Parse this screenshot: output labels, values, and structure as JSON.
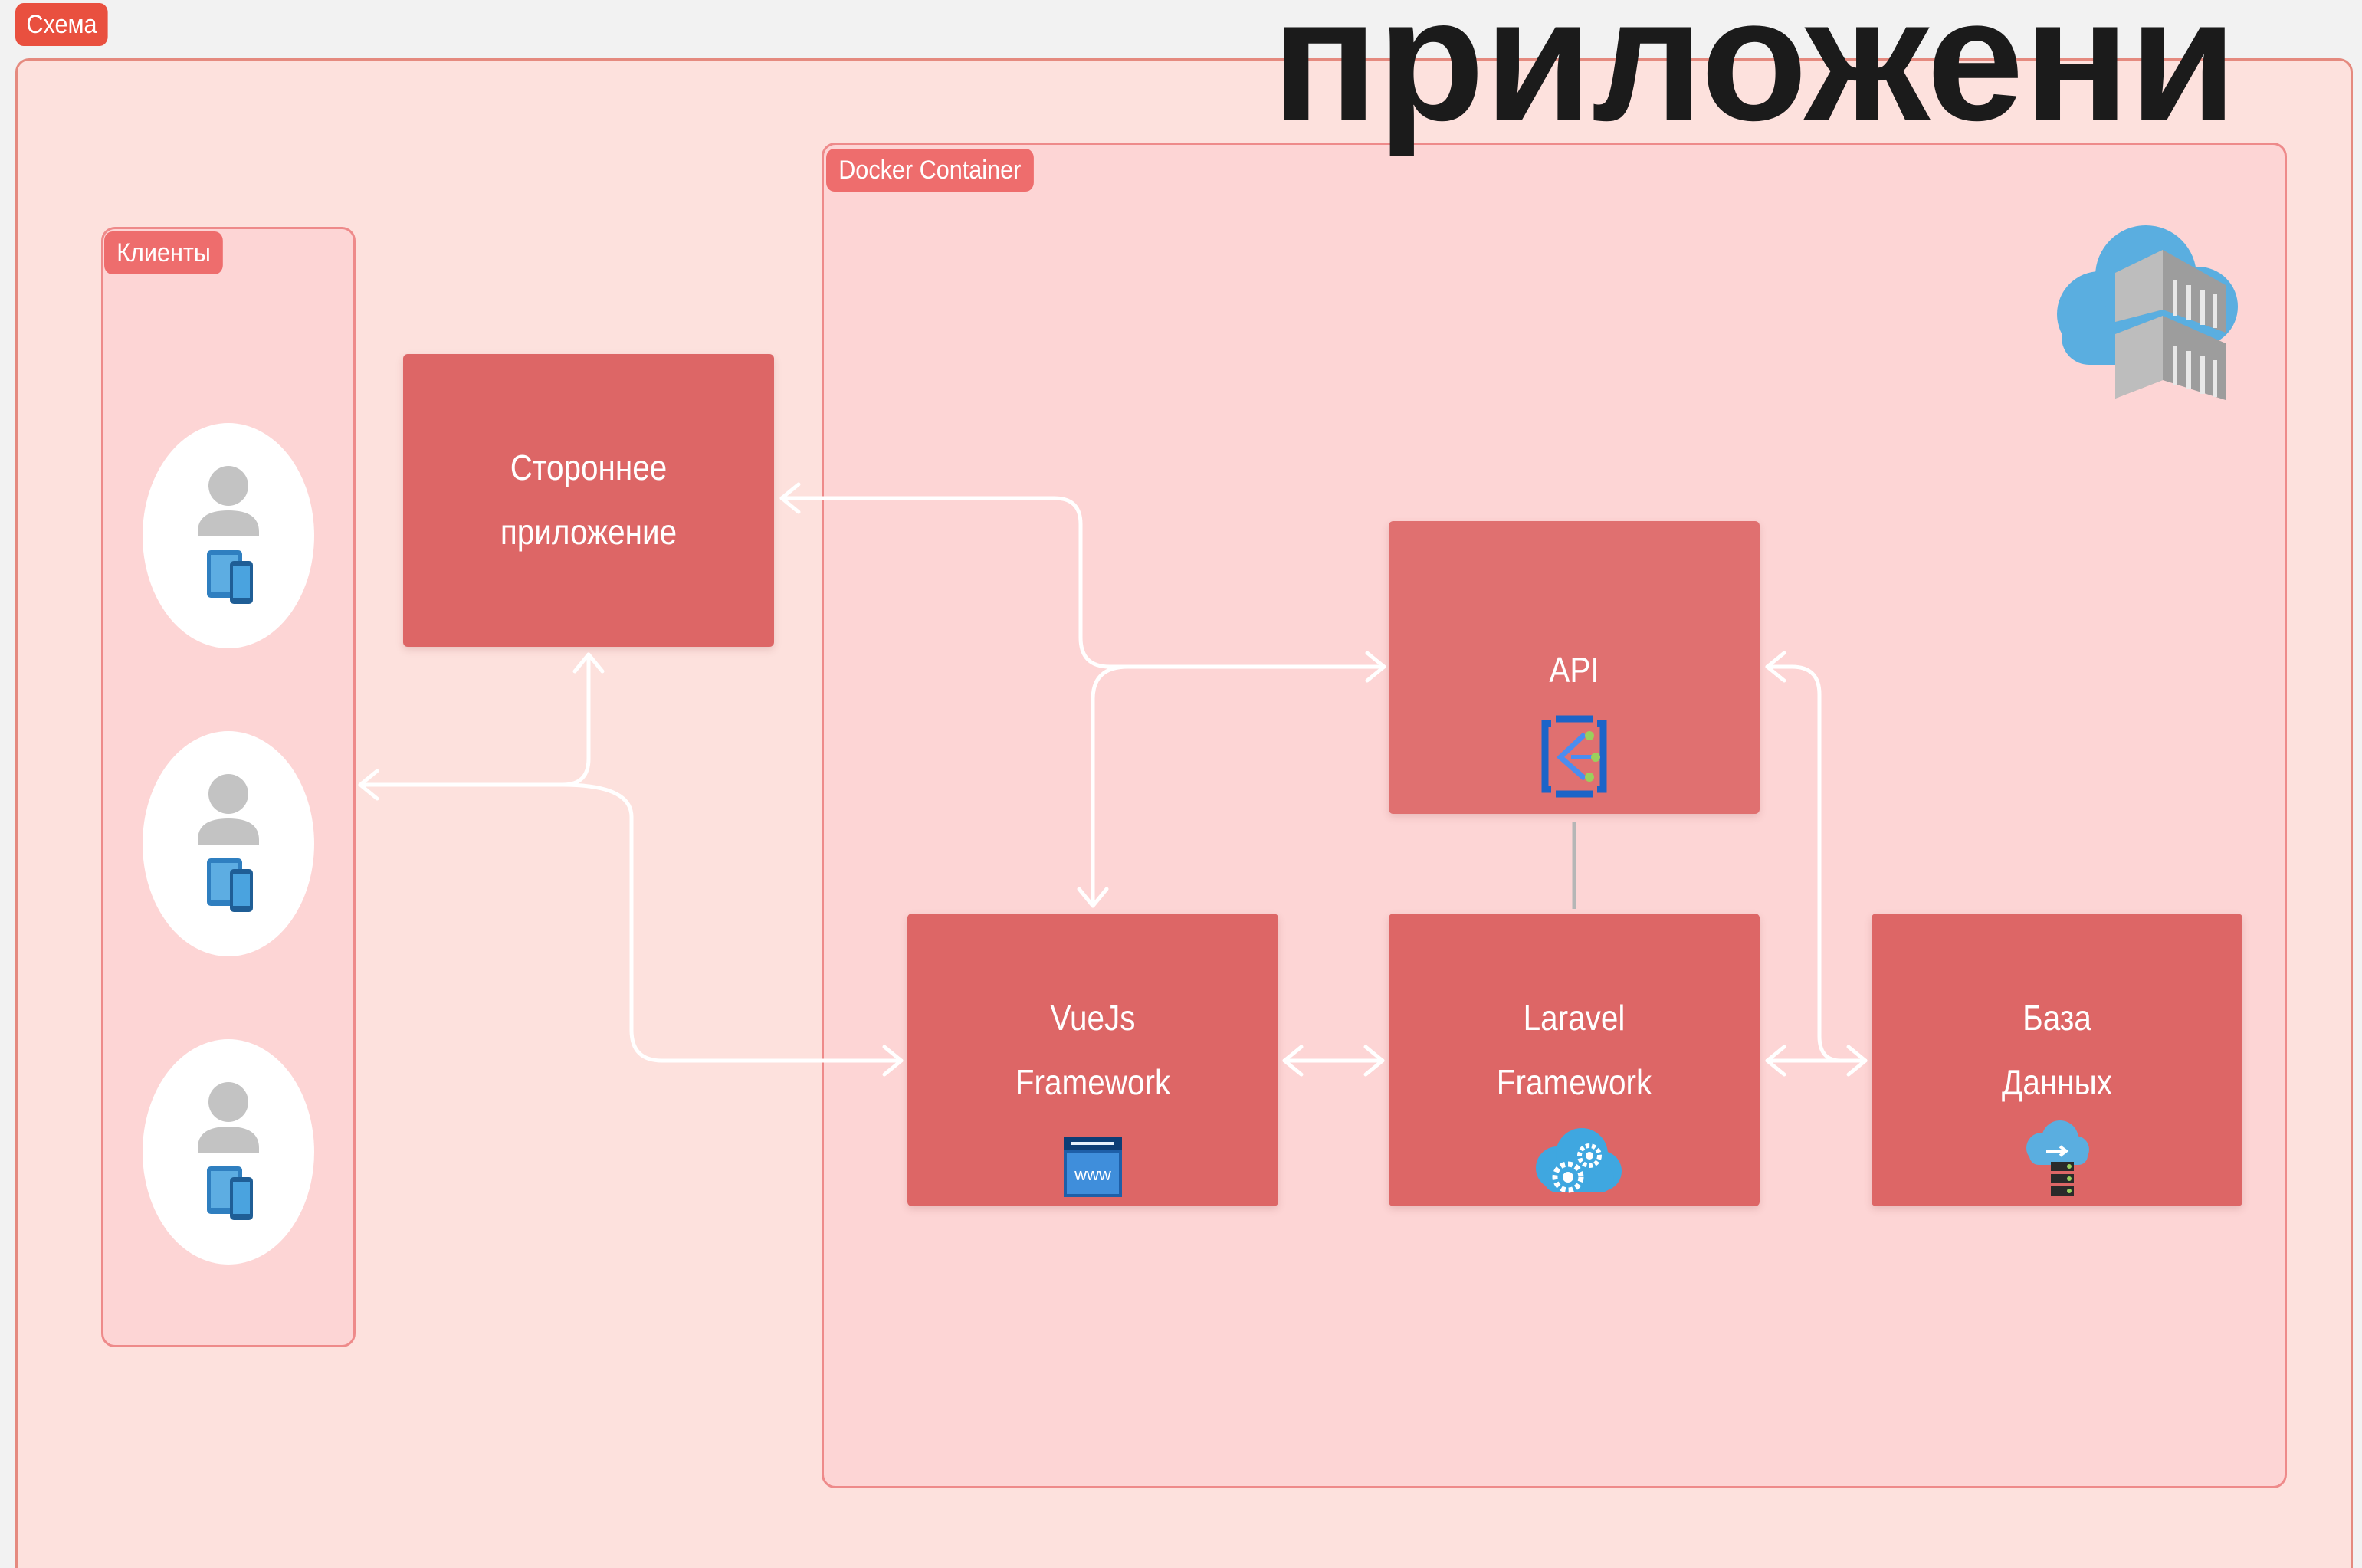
{
  "title": "приложени",
  "groups": {
    "schema": "Схема",
    "clients": "Клиенты",
    "docker": "Docker Container"
  },
  "nodes": {
    "third_party": [
      "Стороннее",
      "приложение"
    ],
    "api": [
      "API"
    ],
    "vuejs": [
      "VueJs",
      "Framework"
    ],
    "laravel": [
      "Laravel",
      "Framework"
    ],
    "database": [
      "База",
      "Данных"
    ]
  },
  "icons": {
    "docker": "cloud-container-icon",
    "client": "user-devices-icon",
    "api": "api-management-icon",
    "vuejs": "web-browser-icon",
    "laravel": "cloud-gears-icon",
    "database": "cloud-database-icon",
    "www_text": "www"
  },
  "colors": {
    "background": "#f2f2f2",
    "outer_fill": "#fde1dd",
    "outer_border": "#e58a7f",
    "inner_fill": "#fdd5d5",
    "inner_border": "#ee8a8a",
    "node": "#dd6666",
    "tag_schema": "#e9503f",
    "tag": "#ee6d6d",
    "connector": "#ffffff",
    "title": "#1b1b1b"
  }
}
